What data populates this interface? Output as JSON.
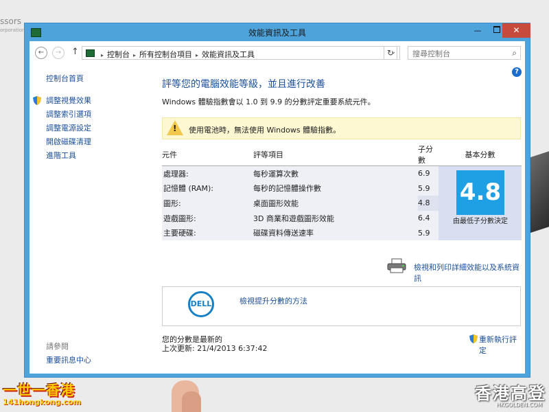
{
  "background": {
    "left_text": "ssors",
    "left_sub": "orporation in",
    "watermark_left_top": "一世一香港",
    "watermark_left_bottom": "141hongkong.com",
    "watermark_right_top": "香港高登",
    "watermark_right_bottom": "HKGOLDEN.COM"
  },
  "window": {
    "title": "效能資訊及工具",
    "controls": {
      "minimize": "—",
      "close": "✕"
    }
  },
  "navigation": {
    "back_glyph": "←",
    "forward_glyph": "→",
    "up_glyph": "↑",
    "breadcrumbs": [
      "控制台",
      "所有控制台項目",
      "效能資訊及工具"
    ],
    "breadcrumb_separator": "▸",
    "dropdown_glyph": "⌄",
    "refresh_glyph": "↻",
    "search_placeholder": "搜尋控制台",
    "search_glyph": "⌕"
  },
  "left_pane": {
    "home": "控制台首頁",
    "links": [
      "調整視覺效果",
      "調整索引選項",
      "調整電源設定",
      "開啟磁碟清理",
      "進階工具"
    ],
    "see_also": "請參閱",
    "action_center": "重要訊息中心"
  },
  "main": {
    "help_glyph": "?",
    "heading": "評等您的電腦效能等級，並且進行改善",
    "intro": "Windows 體驗指數會以 1.0 到 9.9 的分數評定重要系統元件。",
    "warning": "使用電池時，無法使用 Windows 體驗指數。",
    "warning_glyph": "!",
    "table": {
      "headers": {
        "component": "元件",
        "rated": "評等項目",
        "subscore": "子分數",
        "base": "基本分數"
      },
      "rows": [
        {
          "component": "處理器:",
          "rated": "每秒運算次數",
          "subscore": "6.9"
        },
        {
          "component": "記憶體 (RAM):",
          "rated": "每秒的記憶體操作數",
          "subscore": "5.9"
        },
        {
          "component": "圖形:",
          "rated": "桌面圖形效能",
          "subscore": "4.8"
        },
        {
          "component": "遊戲圖形:",
          "rated": "3D 商業和遊戲圖形效能",
          "subscore": "6.4"
        },
        {
          "component": "主要硬碟:",
          "rated": "磁碟資料傳送速率",
          "subscore": "5.9"
        }
      ],
      "base_score": "4.8",
      "base_note": "由最低子分數決定"
    },
    "print_link": "檢視和列印詳細效能以及系統資訊",
    "dell_logo": "DELL",
    "dell_link": "檢視提升分數的方法",
    "up_to_date": "您的分數是最新的",
    "last_update": "上次更新: 21/4/2013 6:37:42",
    "rerun": "重新執行評定"
  },
  "colors": {
    "window_frame": "#4ea3da",
    "close_button": "#c74b3d",
    "link": "#1b4f9c",
    "base_score_tile": "#1fa0e4",
    "warning_bg": "#fdf7d2"
  }
}
